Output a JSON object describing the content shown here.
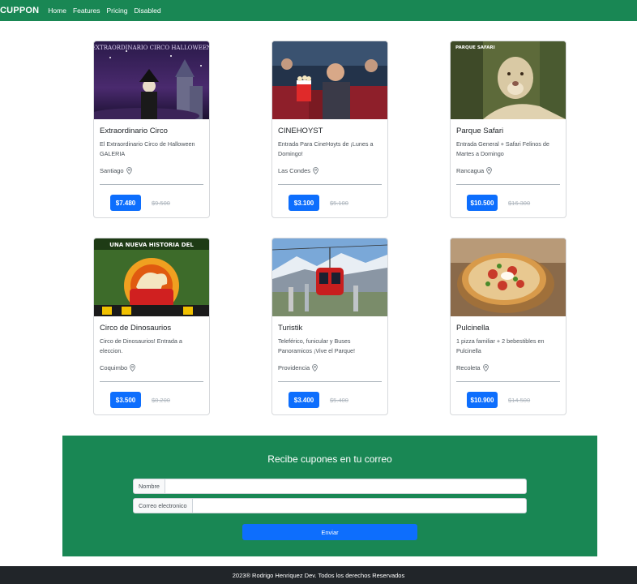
{
  "navbar": {
    "brand": "CUPPON",
    "links": [
      "Home",
      "Features",
      "Pricing",
      "Disabled"
    ]
  },
  "cards": [
    {
      "title": "Extraordinario Circo",
      "description": "El Extraordinario Circo de Halloween GALERIA",
      "location": "Santiago",
      "price": "$7.480",
      "old_price": "$9.500",
      "image_caption": "EXTRAORDINARIO CIRCO HALLOWEEN",
      "image_icon": "circus-halloween-image"
    },
    {
      "title": "CINEHOYST",
      "description": "Entrada Para CineHoyts de ¡Lunes a Domingo!",
      "location": "Las Condes",
      "price": "$3.100",
      "old_price": "$5.100",
      "image_caption": "",
      "image_icon": "cinema-image"
    },
    {
      "title": "Parque Safari",
      "description": "Entrada General + Safari Felinos de Martes a Domingo",
      "location": "Rancagua",
      "price": "$10.500",
      "old_price": "$16.300",
      "image_caption": "PARQUE SAFARI",
      "image_icon": "lion-image"
    },
    {
      "title": "Circo de Dinosaurios",
      "description": "Circo de Dinosaurios! Entrada a eleccion.",
      "location": "Coquimbo",
      "price": "$3.500",
      "old_price": "$8.200",
      "image_caption": "UNA NUEVA HISTORIA DEL",
      "image_icon": "dinosaur-circus-image"
    },
    {
      "title": "Turistik",
      "description": "Teleférico, funicular y Buses Panoramicos ¡Vive el Parque!",
      "location": "Providencia",
      "price": "$3.400",
      "old_price": "$5.400",
      "image_caption": "",
      "image_icon": "cable-car-image"
    },
    {
      "title": "Pulcinella",
      "description": "1 pizza familiar + 2 bebestibles en Pulcinella",
      "location": "Recoleta",
      "price": "$10.900",
      "old_price": "$14.500",
      "image_caption": "",
      "image_icon": "pizza-image"
    }
  ],
  "newsletter": {
    "title": "Recibe cupones en tu correo",
    "name_label": "Nombre",
    "name_value": "",
    "email_label": "Correo electronico",
    "email_value": "",
    "send_label": "Enviar"
  },
  "footer": {
    "text": "2023® Rodrigo Henriquez Dev. Todos los derechos Reservados"
  },
  "colors": {
    "primary_green": "#198754",
    "button_blue": "#0d6efd",
    "footer_dark": "#212529"
  }
}
